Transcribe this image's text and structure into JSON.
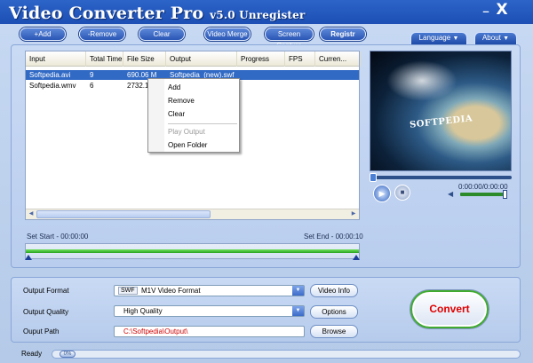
{
  "window": {
    "title": "Video Converter Pro",
    "version": "v5.0 Unregister",
    "min_glyph": "_",
    "close_glyph": "X"
  },
  "toolbar": {
    "add": "+Add",
    "remove": "-Remove",
    "clear": "Clear",
    "video_merge": "Video Merge",
    "screen_capture": "Screen Capture",
    "register": "Registr",
    "language": "Language",
    "about": "About"
  },
  "file_list": {
    "columns": [
      "Input",
      "Total Time",
      "File Size",
      "Output",
      "Progress",
      "FPS",
      "Curren..."
    ],
    "rows": [
      {
        "input": "Softpedia.avi",
        "total_time": "9",
        "file_size": "690.06 M",
        "output": "Softpedia_(new).swf",
        "progress": "",
        "fps": "",
        "current": "",
        "selected": true
      },
      {
        "input": "Softpedia.wmv",
        "total_time": "6",
        "file_size": "2732.1",
        "output": "",
        "progress": "",
        "fps": "",
        "current": "",
        "selected": false
      }
    ]
  },
  "context_menu": {
    "items": [
      "Add",
      "Remove",
      "Clear",
      "Play Output",
      "Open Folder"
    ],
    "disabled": [
      "Play Output"
    ]
  },
  "preview": {
    "watermark": "SOFTPEDIA",
    "time": "0:00:00/0:00:00",
    "position_fraction": 0,
    "volume_fraction": 1
  },
  "timeline": {
    "set_start": "Set Start - 00:00:00",
    "set_end": "Set End - 00:00:10"
  },
  "settings": {
    "output_format_label": "Output Format",
    "output_format_badge": "SWF",
    "output_format_value": "M1V Video Format",
    "output_quality_label": "Output Quality",
    "output_quality_value": "High Quality",
    "output_path_label": "Ouput Path",
    "output_path_value": "C:\\Softpedia\\Output\\",
    "video_info": "Video Info",
    "options": "Options",
    "browse": "Browse",
    "convert": "Convert"
  },
  "status": {
    "text": "Ready",
    "progress_fraction": 0,
    "knob_label": "0%"
  },
  "colors": {
    "title_bar": "#1d4fb4",
    "selection": "#316ac5",
    "convert_text": "#e00000",
    "path_text": "#d00000",
    "timeline_bar": "#2aa422"
  }
}
